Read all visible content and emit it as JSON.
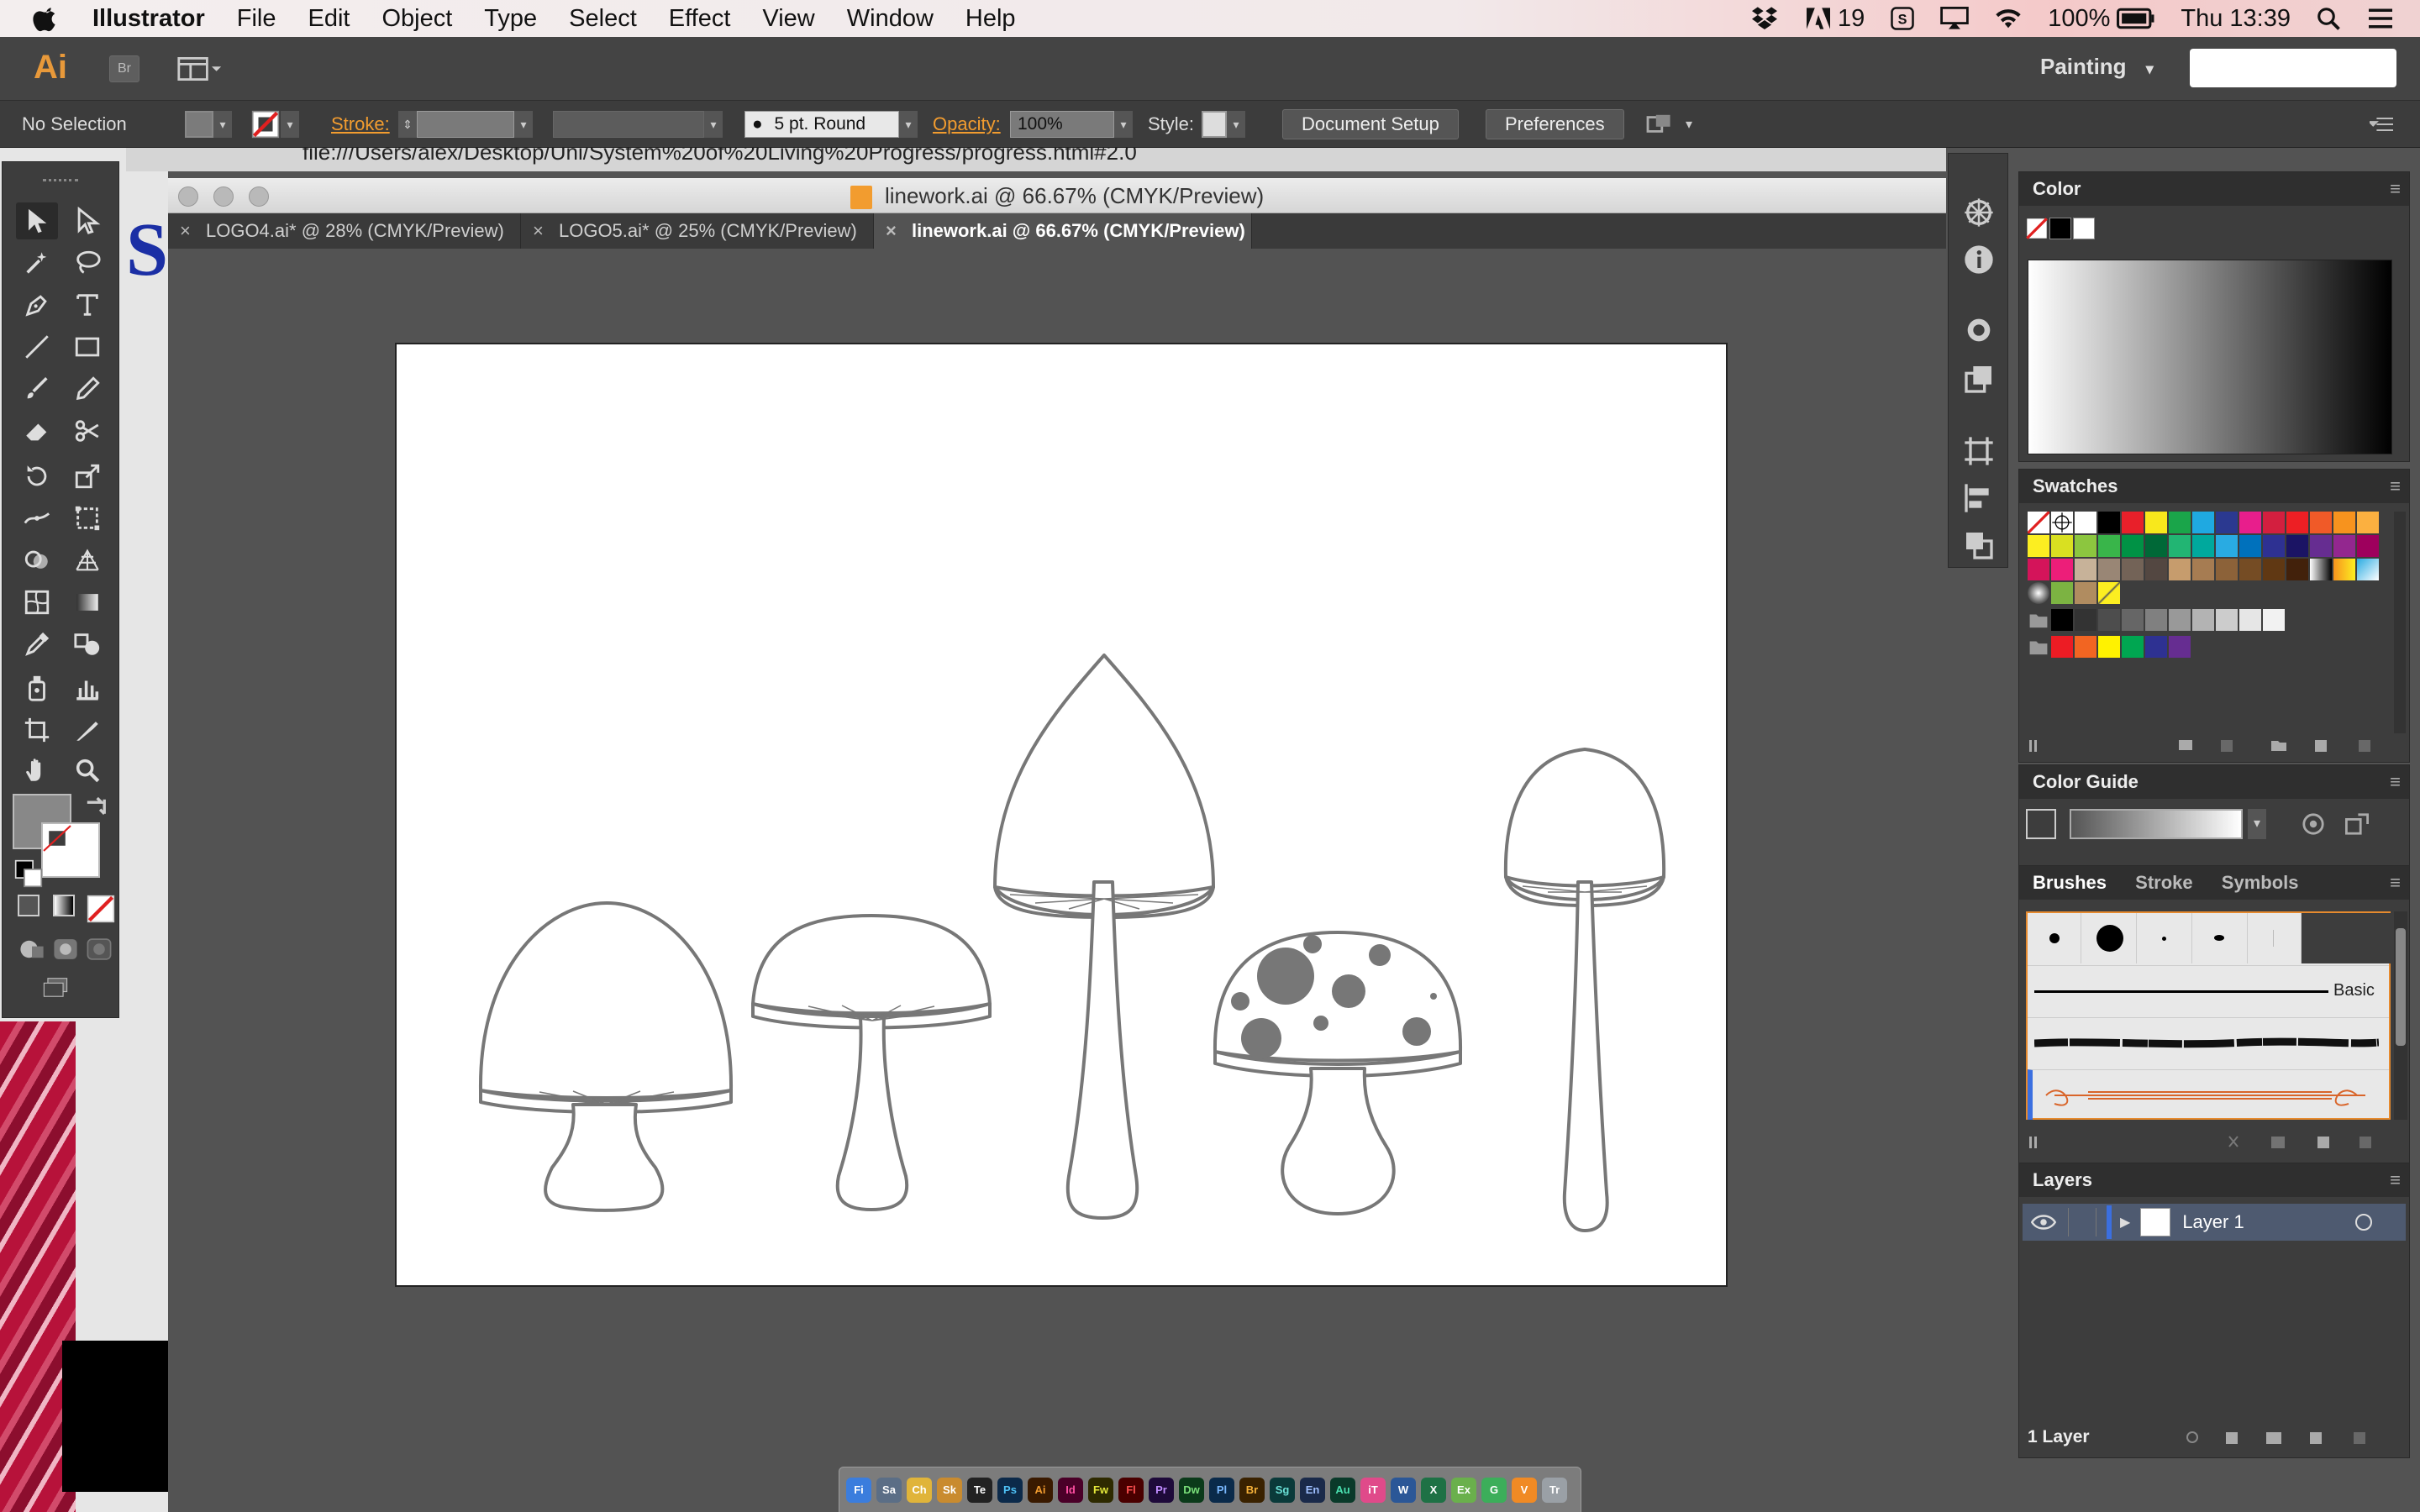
{
  "menubar": {
    "app_name": "Illustrator",
    "items": [
      "File",
      "Edit",
      "Object",
      "Type",
      "Select",
      "Effect",
      "View",
      "Window",
      "Help"
    ],
    "status": {
      "adobe_badge": "19",
      "battery": "100%",
      "clock": "Thu 13:39"
    }
  },
  "appbar": {
    "logo": "Ai",
    "bridge_label": "Br",
    "workspace": "Painting"
  },
  "controlbar": {
    "selection": "No Selection",
    "stroke_label": "Stroke:",
    "brush": "5 pt. Round",
    "opacity_label": "Opacity:",
    "opacity_value": "100%",
    "style_label": "Style:",
    "document_setup": "Document Setup",
    "preferences": "Preferences"
  },
  "background": {
    "url_text": "file:///Users/alex/Desktop/Uni/System%20of%20Living%20Progress/progress.html#2.0",
    "partial_letter": "S"
  },
  "document": {
    "window_title": "linework.ai @ 66.67% (CMYK/Preview)",
    "tabs": [
      {
        "label": "LOGO4.ai* @ 28% (CMYK/Preview)"
      },
      {
        "label": "LOGO5.ai* @ 25% (CMYK/Preview)"
      },
      {
        "label": "linework.ai @ 66.67% (CMYK/Preview)"
      }
    ]
  },
  "panels": {
    "color": {
      "title": "Color"
    },
    "swatches": {
      "title": "Swatches"
    },
    "color_guide": {
      "title": "Color Guide"
    },
    "brushes": {
      "tabs": [
        "Brushes",
        "Stroke",
        "Symbols"
      ],
      "basic_label": "Basic"
    },
    "layers": {
      "title": "Layers",
      "layer_name": "Layer 1",
      "footer": "1 Layer"
    }
  },
  "dock": {
    "apps": [
      "Fi",
      "Sa",
      "Ch",
      "Sk",
      "Te",
      "Ps",
      "Ai",
      "Id",
      "Fw",
      "Fl",
      "Pr",
      "Dw",
      "Pl",
      "Br",
      "Sg",
      "En",
      "Au",
      "iT",
      "W",
      "X",
      "Ex",
      "G",
      "V",
      "Tr"
    ]
  },
  "colors": {
    "accent_orange": "#f29c2f",
    "selected_layer": "#4e5a70"
  }
}
